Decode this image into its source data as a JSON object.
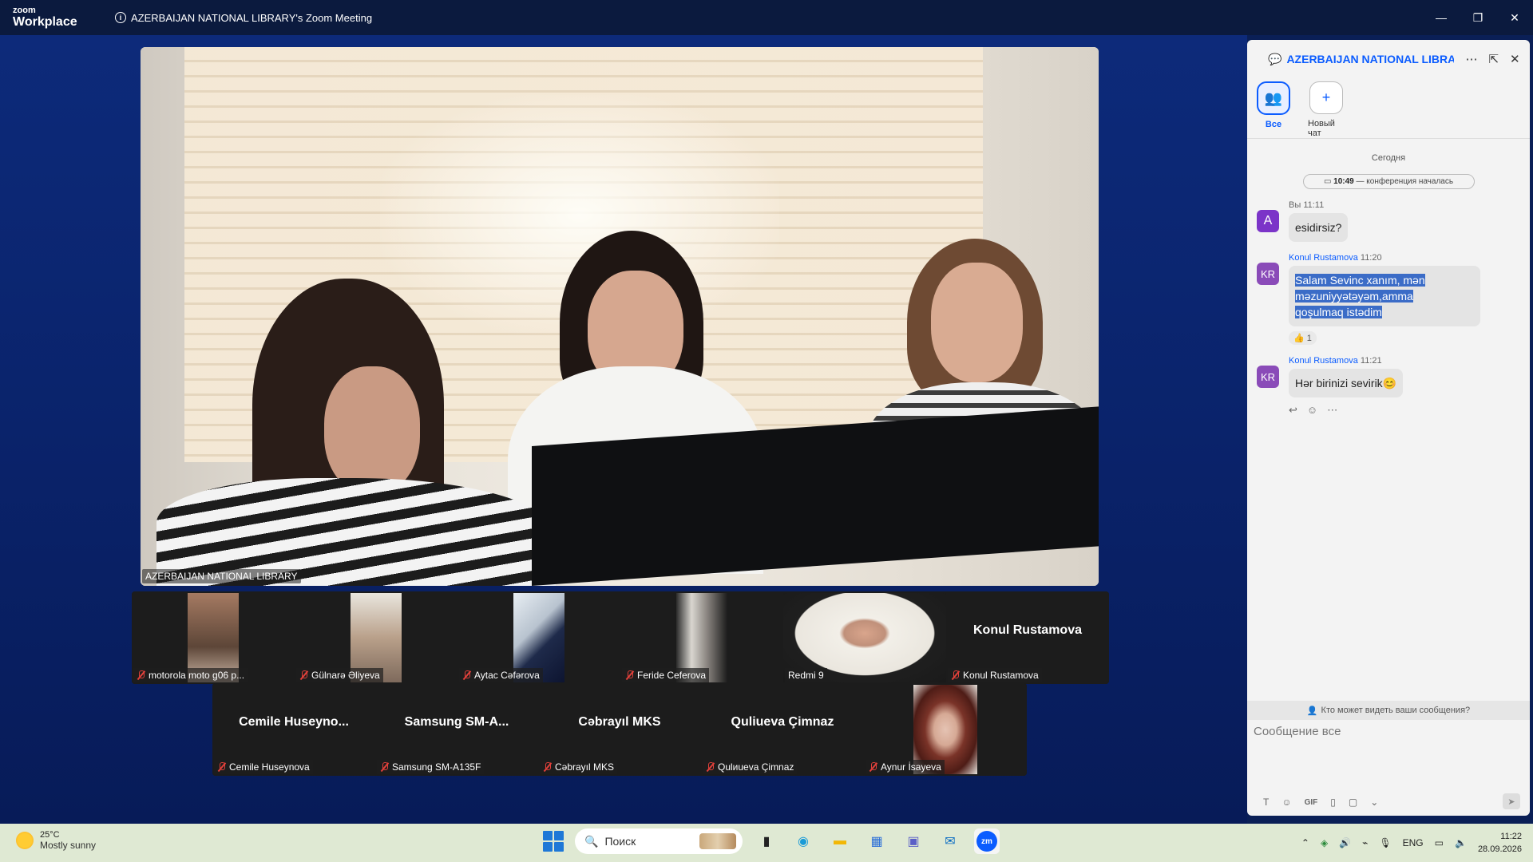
{
  "window": {
    "app_logo_line1": "zoom",
    "app_logo_line2": "Workplace",
    "title": "AZERBAIJAN NATIONAL LIBRARY's Zoom Meeting",
    "minimize": "—",
    "restore": "❐",
    "close": "✕"
  },
  "main_video": {
    "label": "AZERBAIJAN NATIONAL LIBRARY"
  },
  "gallery_row1": [
    {
      "label": "motorola moto g06 p...",
      "muted": true,
      "has_video": true
    },
    {
      "label": "Gülnarə Əliyeva",
      "muted": true,
      "has_video": true
    },
    {
      "label": "Aytac Cəfərova",
      "muted": true,
      "has_video": true
    },
    {
      "label": "Feride Ceferova",
      "muted": true,
      "has_video": true
    },
    {
      "label": "Redmi 9",
      "muted": false,
      "has_video": true
    },
    {
      "label": "Konul Rustamova",
      "name_big": "Konul Rustamova",
      "muted": true,
      "has_video": false
    }
  ],
  "gallery_row2": [
    {
      "label": "Cemile Huseynova",
      "name_big": "Cemile  Huseyno...",
      "muted": true
    },
    {
      "label": "Samsung SM-A135F",
      "name_big": "Samsung  SM-A...",
      "muted": true
    },
    {
      "label": "Cəbrayıl MKS",
      "name_big": "Cəbrayıl MKS",
      "muted": true
    },
    {
      "label": "Qulиueva Çimnaz",
      "name_big": "Quliueva Çimnaz",
      "muted": true
    },
    {
      "label": "Aynur İsayeva",
      "muted": true,
      "has_video": true
    }
  ],
  "chat": {
    "title": "AZERBAIJAN NATIONAL LIBRA...",
    "tabs": [
      {
        "label": "Все",
        "icon": "people-icon",
        "active": true
      },
      {
        "label": "Новый чат",
        "icon": "plus-icon",
        "active": false
      }
    ],
    "day_separator": "Сегодня",
    "meeting_started_time": "10:49",
    "meeting_started_text": " — конференция началась",
    "messages": [
      {
        "sender": "Вы",
        "time": "11:11",
        "avatar": "A",
        "text": "esidirsiz?"
      },
      {
        "sender": "Konul Rustamova",
        "time": "11:20",
        "avatar": "KR",
        "lines": [
          "Salam Sevinc xanım, mən",
          "məzuniyyətəyəm,amma",
          "qoşulmaq istədim"
        ],
        "reaction": "👍 1"
      },
      {
        "sender": "Konul Rustamova",
        "time": "11:21",
        "avatar": "KR",
        "text": "Hər birinizi sevirik😊"
      }
    ],
    "who_can_see": "Кто может видеть ваши сообщения?",
    "composer_placeholder": "Сообщение все",
    "tool_gif": "GIF"
  },
  "taskbar": {
    "temperature": "25°C",
    "weather": "Mostly sunny",
    "search_placeholder": "Поиск",
    "language": "ENG",
    "time": "11:22",
    "date": "28.09.2026"
  }
}
